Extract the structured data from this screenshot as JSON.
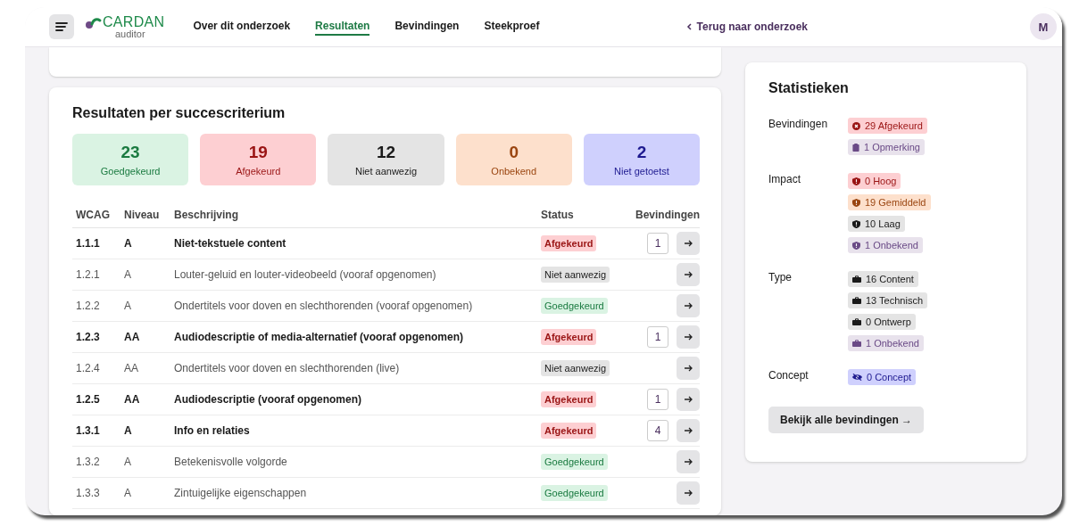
{
  "header": {
    "logo": {
      "name": "CARDAN",
      "sub": "auditor"
    },
    "nav": [
      {
        "label": "Over dit onderzoek",
        "selected": false
      },
      {
        "label": "Resultaten",
        "selected": true
      },
      {
        "label": "Bevindingen",
        "selected": false
      },
      {
        "label": "Steekproef",
        "selected": false
      }
    ],
    "back_link": "Terug naar onderzoek",
    "avatar": "M"
  },
  "results": {
    "title": "Resultaten per succescriterium",
    "summary": [
      {
        "count": "23",
        "label": "Goedgekeurd",
        "kind": "passed"
      },
      {
        "count": "19",
        "label": "Afgekeurd",
        "kind": "failed"
      },
      {
        "count": "12",
        "label": "Niet aanwezig",
        "kind": "absent"
      },
      {
        "count": "0",
        "label": "Onbekend",
        "kind": "unknown"
      },
      {
        "count": "2",
        "label": "Niet getoetst",
        "kind": "untested"
      }
    ],
    "columns": [
      "WCAG",
      "Niveau",
      "Beschrijving",
      "Status",
      "Bevindingen"
    ],
    "rows": [
      {
        "wcag": "1.1.1",
        "level": "A",
        "description": "Niet-tekstuele content",
        "status": "Afgekeurd",
        "kind": "failed",
        "findings": "1"
      },
      {
        "wcag": "1.2.1",
        "level": "A",
        "description": "Louter-geluid en louter-videobeeld (vooraf opgenomen)",
        "status": "Niet aanwezig",
        "kind": "absent"
      },
      {
        "wcag": "1.2.2",
        "level": "A",
        "description": "Ondertitels voor doven en slechthorenden (vooraf opgenomen)",
        "status": "Goedgekeurd",
        "kind": "passed"
      },
      {
        "wcag": "1.2.3",
        "level": "AA",
        "description": "Audiodescriptie of media-alternatief (vooraf opgenomen)",
        "status": "Afgekeurd",
        "kind": "failed",
        "findings": "1"
      },
      {
        "wcag": "1.2.4",
        "level": "AA",
        "description": "Ondertitels voor doven en slechthorenden (live)",
        "status": "Niet aanwezig",
        "kind": "absent"
      },
      {
        "wcag": "1.2.5",
        "level": "AA",
        "description": "Audiodescriptie (vooraf opgenomen)",
        "status": "Afgekeurd",
        "kind": "failed",
        "findings": "1"
      },
      {
        "wcag": "1.3.1",
        "level": "A",
        "description": "Info en relaties",
        "status": "Afgekeurd",
        "kind": "failed",
        "findings": "4"
      },
      {
        "wcag": "1.3.2",
        "level": "A",
        "description": "Betekenisvolle volgorde",
        "status": "Goedgekeurd",
        "kind": "passed"
      },
      {
        "wcag": "1.3.3",
        "level": "A",
        "description": "Zintuigelijke eigenschappen",
        "status": "Goedgekeurd",
        "kind": "passed"
      }
    ]
  },
  "statistics": {
    "title": "Statistieken",
    "groups": [
      {
        "label": "Bevindingen",
        "badges": [
          {
            "text": "29 Afgekeurd",
            "kind": "red"
          },
          {
            "text": "1 Opmerking",
            "kind": "purple"
          }
        ]
      },
      {
        "label": "Impact",
        "badges": [
          {
            "text": "0 Hoog",
            "kind": "red"
          },
          {
            "text": "19 Gemiddeld",
            "kind": "orange"
          },
          {
            "text": "10 Laag",
            "kind": "grey"
          },
          {
            "text": "1 Onbekend",
            "kind": "purple"
          }
        ]
      },
      {
        "label": "Type",
        "badges": [
          {
            "text": "16 Content",
            "kind": "grey"
          },
          {
            "text": "13 Technisch",
            "kind": "grey"
          },
          {
            "text": "0 Ontwerp",
            "kind": "grey"
          },
          {
            "text": "1 Onbekend",
            "kind": "purple"
          }
        ]
      },
      {
        "label": "Concept",
        "badges": [
          {
            "text": "0 Concept",
            "kind": "blue"
          }
        ]
      }
    ],
    "button": "Bekijk alle bevindingen →"
  }
}
